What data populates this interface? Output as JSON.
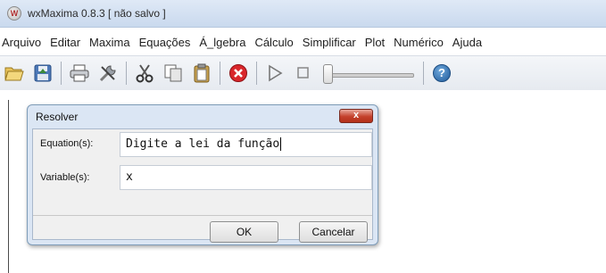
{
  "window": {
    "title": "wxMaxima 0.8.3 [ não salvo ]",
    "icon": "wxmaxima-app-icon"
  },
  "menu": [
    "Arquivo",
    "Editar",
    "Maxima",
    "Equações",
    "Á_lgebra",
    "Cálculo",
    "Simplificar",
    "Plot",
    "Numérico",
    "Ajuda"
  ],
  "toolbar": {
    "icons": [
      "open-folder-icon",
      "save-icon",
      "print-icon",
      "settings-icon",
      "cut-icon",
      "copy-icon",
      "paste-icon",
      "interrupt-icon",
      "play-icon",
      "stop-icon",
      "animation-slider",
      "help-icon"
    ],
    "slider_value": 0
  },
  "dialog": {
    "title": "Resolver",
    "close_label": "x",
    "equation_label": "Equation(s):",
    "equation_value": "Digite a lei da função",
    "variable_label": "Variable(s):",
    "variable_value": "x",
    "ok_label": "OK",
    "cancel_label": "Cancelar"
  },
  "colors": {
    "titlebar": "#c9d9ee",
    "dialog_frame": "#dbe6f4",
    "close_button": "#c4412c",
    "interrupt_red": "#d9262b"
  }
}
